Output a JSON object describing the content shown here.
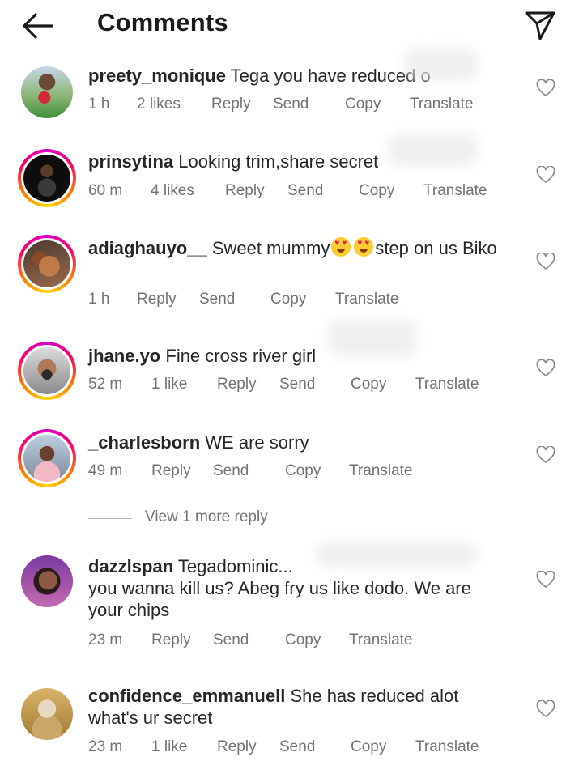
{
  "header": {
    "title": "Comments",
    "back_icon": "arrow-left-icon",
    "share_icon": "paper-plane-icon"
  },
  "actions": {
    "reply": "Reply",
    "send": "Send",
    "copy": "Copy",
    "translate": "Translate"
  },
  "comments": [
    {
      "username": "preety_monique",
      "text": "Tega you have reduced o",
      "time": "1 h",
      "likes": "2 likes",
      "ring": false
    },
    {
      "username": "prinsytina",
      "text": "Looking trim,share secret",
      "time": "60 m",
      "likes": "4 likes",
      "ring": true
    },
    {
      "username": "adiaghauyo__",
      "text_before": "Sweet mummy",
      "text_after": "step on us Biko",
      "time": "1 h",
      "likes": "",
      "ring": true
    },
    {
      "username": "jhane.yo",
      "text": "Fine cross river girl",
      "time": "52 m",
      "likes": "1 like",
      "ring": true
    },
    {
      "username": "_charlesborn",
      "text": "WE are sorry",
      "time": "49 m",
      "likes": "",
      "ring": true
    },
    {
      "username": "dazzlspan",
      "text_first": "Tegadominic...",
      "text_rest": "you wanna kill us? Abeg fry us like dodo. We are your chips",
      "time": "23 m",
      "likes": "",
      "ring": false
    },
    {
      "username": "confidence_emmanuell",
      "text": "She has reduced alot what's ur secret",
      "time": "23 m",
      "likes": "1 like",
      "ring": false
    }
  ],
  "view_more_replies": "View 1 more reply",
  "colors": {
    "text": "#262626",
    "meta": "#737373",
    "story_ring": [
      "#d300c5",
      "#ff0069",
      "#ff7a00",
      "#ffd600"
    ]
  }
}
